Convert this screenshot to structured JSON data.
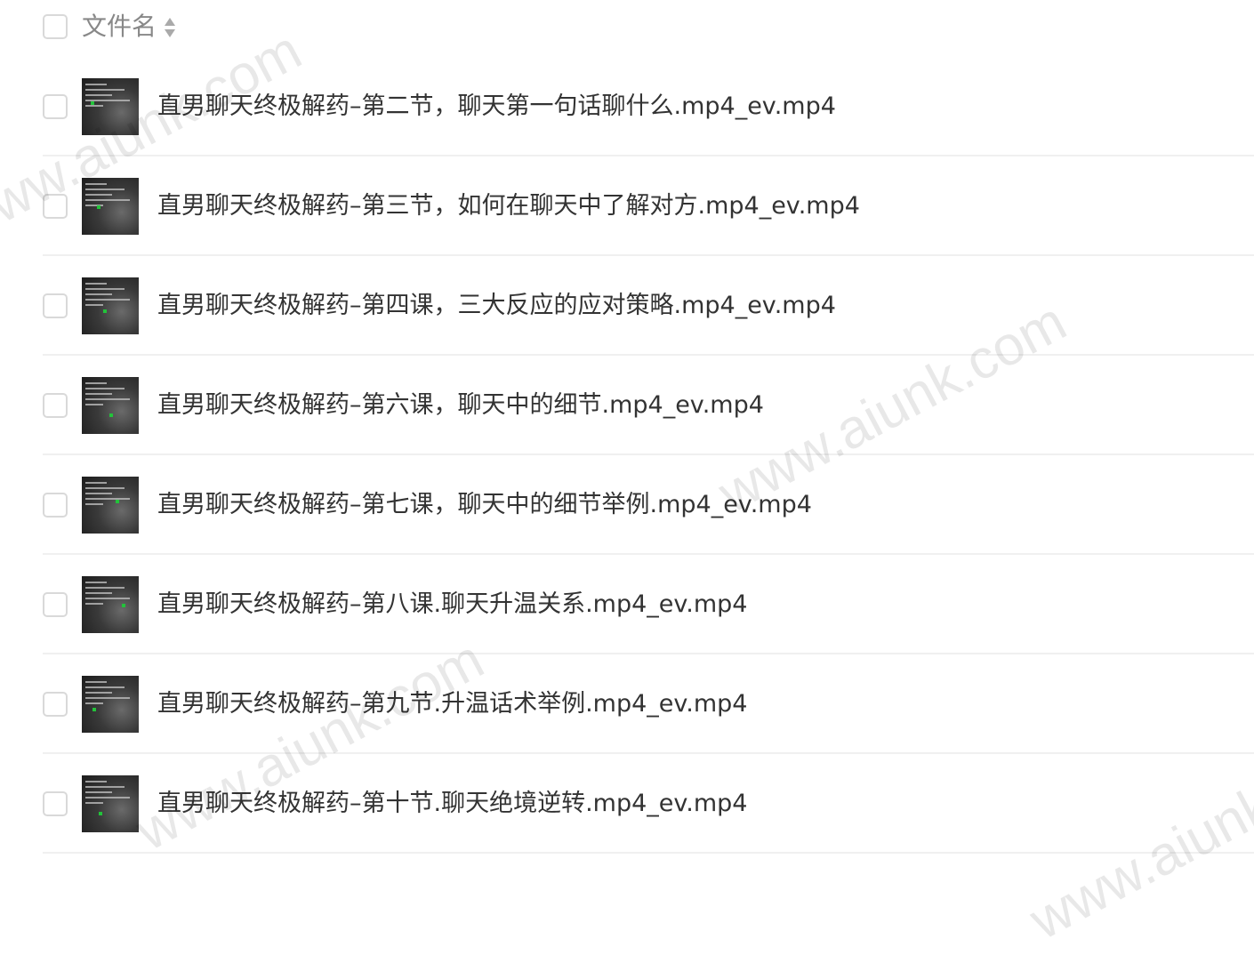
{
  "header": {
    "label": "文件名"
  },
  "files": [
    {
      "name": "直男聊天终极解药–第二节，聊天第一句话聊什么.mp4_ev.mp4"
    },
    {
      "name": "直男聊天终极解药–第三节，如何在聊天中了解对方.mp4_ev.mp4"
    },
    {
      "name": "直男聊天终极解药–第四课，三大反应的应对策略.mp4_ev.mp4"
    },
    {
      "name": "直男聊天终极解药–第六课，聊天中的细节.mp4_ev.mp4"
    },
    {
      "name": "直男聊天终极解药–第七课，聊天中的细节举例.mp4_ev.mp4"
    },
    {
      "name": "直男聊天终极解药–第八课.聊天升温关系.mp4_ev.mp4"
    },
    {
      "name": "直男聊天终极解药–第九节.升温话术举例.mp4_ev.mp4"
    },
    {
      "name": "直男聊天终极解药–第十节.聊天绝境逆转.mp4_ev.mp4"
    }
  ],
  "watermark": {
    "text": "www.aiunk.com"
  }
}
